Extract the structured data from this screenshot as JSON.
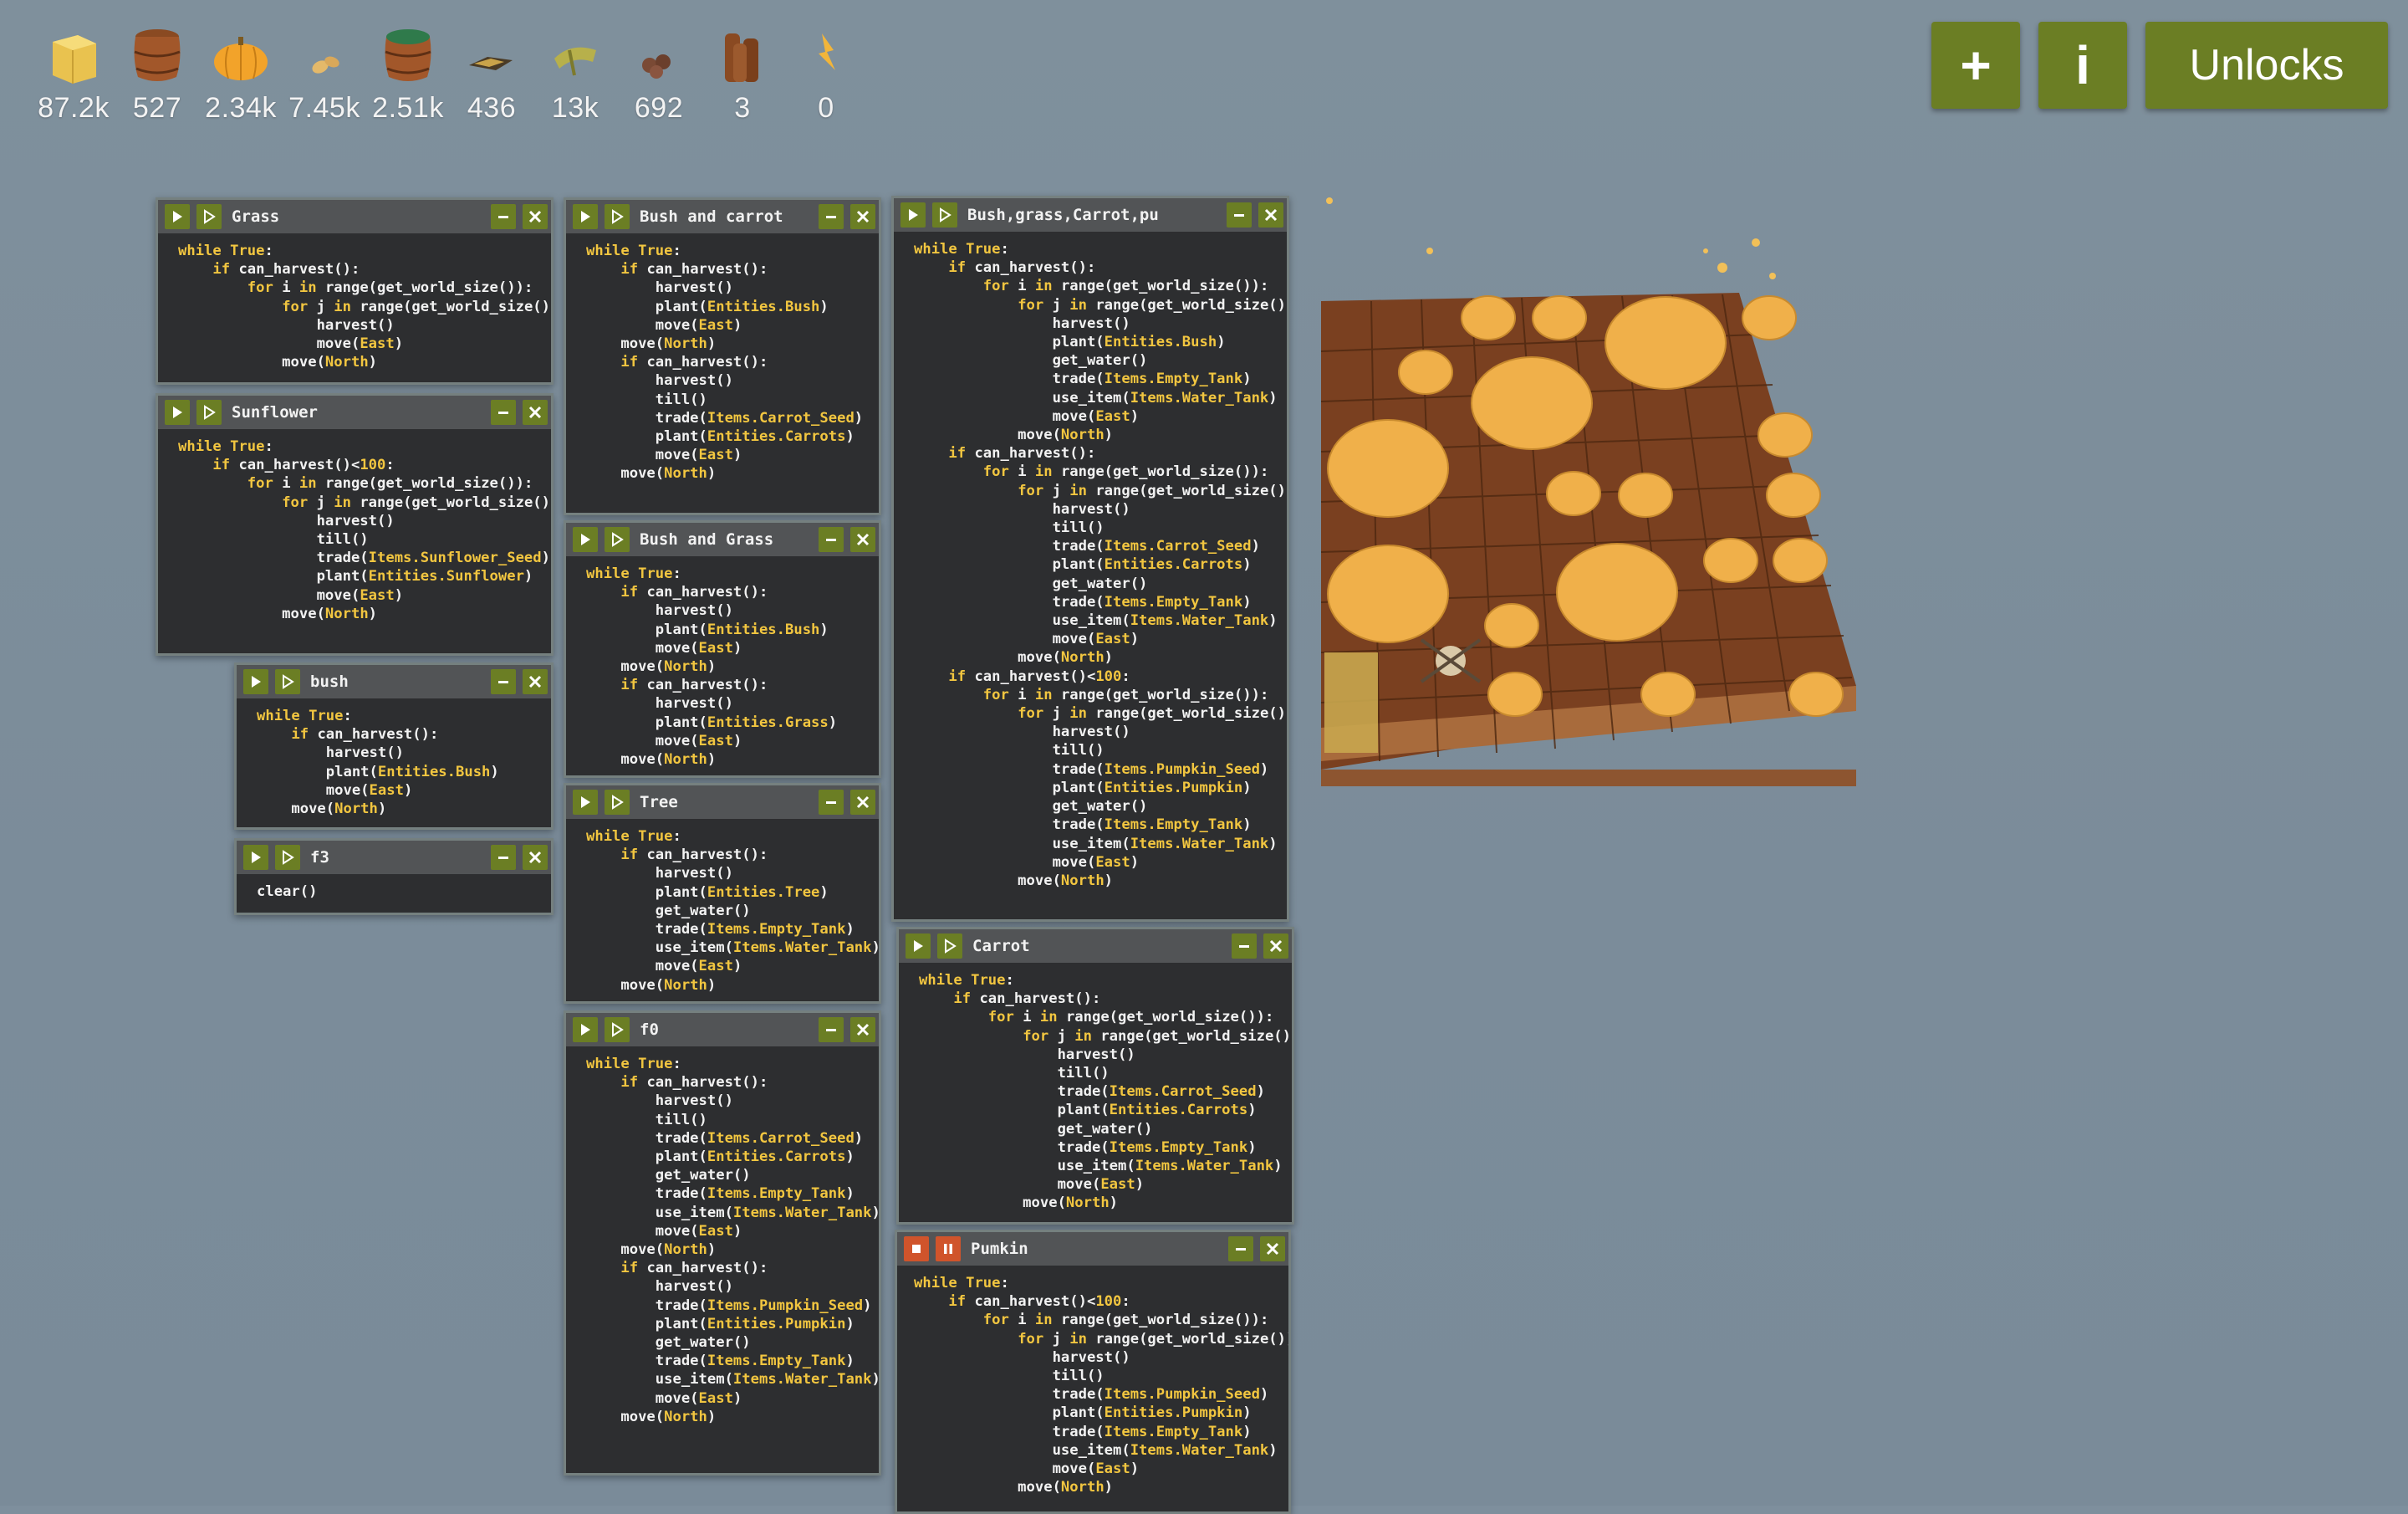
{
  "resources": [
    {
      "icon": "hay-icon",
      "value": "87.2k"
    },
    {
      "icon": "wood-barrel-icon",
      "value": "527"
    },
    {
      "icon": "pumpkin-icon",
      "value": "2.34k"
    },
    {
      "icon": "seed-icon",
      "value": "7.45k"
    },
    {
      "icon": "water-barrel-icon",
      "value": "2.51k"
    },
    {
      "icon": "gold-icon",
      "value": "436"
    },
    {
      "icon": "cactus-icon",
      "value": "13k"
    },
    {
      "icon": "bones-icon",
      "value": "692"
    },
    {
      "icon": "logs-icon",
      "value": "3"
    },
    {
      "icon": "power-icon",
      "value": "0"
    }
  ],
  "toolbar": {
    "add_label": "+",
    "info_label": "i",
    "unlocks_label": "Unlocks"
  },
  "windows": {
    "grass": {
      "title": "Grass"
    },
    "sunflower": {
      "title": "Sunflower"
    },
    "bush": {
      "title": "bush"
    },
    "f3": {
      "title": "f3"
    },
    "bush_carrot": {
      "title": "Bush and carrot"
    },
    "bush_grass": {
      "title": "Bush and Grass"
    },
    "tree": {
      "title": "Tree"
    },
    "f0": {
      "title": "f0"
    },
    "combo": {
      "title": "Bush,grass,Carrot,pu"
    },
    "carrot": {
      "title": "Carrot"
    },
    "pumkin": {
      "title": "Pumkin"
    }
  },
  "colors": {
    "accent": "#6b7e24",
    "window_bg": "#2d2e30",
    "titlebar": "#525456",
    "stop": "#d0542b",
    "keyword": "#f2c640"
  }
}
